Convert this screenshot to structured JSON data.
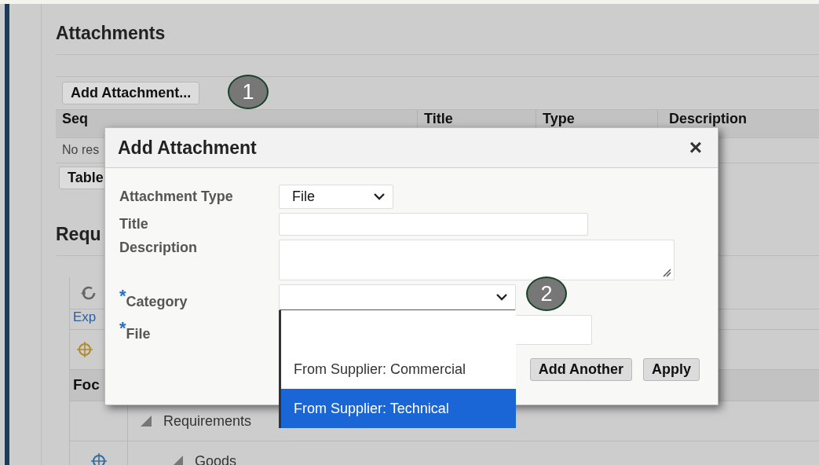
{
  "page": {
    "heading": "Attachments",
    "add_button": "Add Attachment...",
    "table": {
      "columns": [
        {
          "label": "Seq"
        },
        {
          "label": "Title"
        },
        {
          "label": "Type"
        },
        {
          "label": "Description"
        }
      ],
      "empty_text": "No res",
      "button": "Table"
    },
    "section_heading": "Requ",
    "tree": {
      "expand_link": "Exp",
      "focus_header": "Foc",
      "rows": [
        {
          "label": "Requirements",
          "expanded": true,
          "focus_icon": false,
          "children": [
            {
              "label": "Goods",
              "expanded": true,
              "focus_icon": true
            }
          ]
        }
      ]
    }
  },
  "callouts": [
    "1",
    "2"
  ],
  "dialog": {
    "title": "Add Attachment",
    "close": "×",
    "required_mark": "*",
    "fields": [
      {
        "kind": "select",
        "label": "Attachment Type",
        "required": false,
        "value": "File"
      },
      {
        "kind": "text",
        "label": "Title",
        "required": false
      },
      {
        "kind": "textarea",
        "label": "Description",
        "required": false
      },
      {
        "kind": "select",
        "label": "Category",
        "required": true,
        "open": true
      },
      {
        "kind": "text",
        "label": "File",
        "required": true
      }
    ],
    "options": [
      {
        "label": "From Supplier: Commercial",
        "selected": false
      },
      {
        "label": "From Supplier: Technical",
        "selected": true
      }
    ],
    "buttons": [
      "Add Another",
      "Apply"
    ]
  }
}
